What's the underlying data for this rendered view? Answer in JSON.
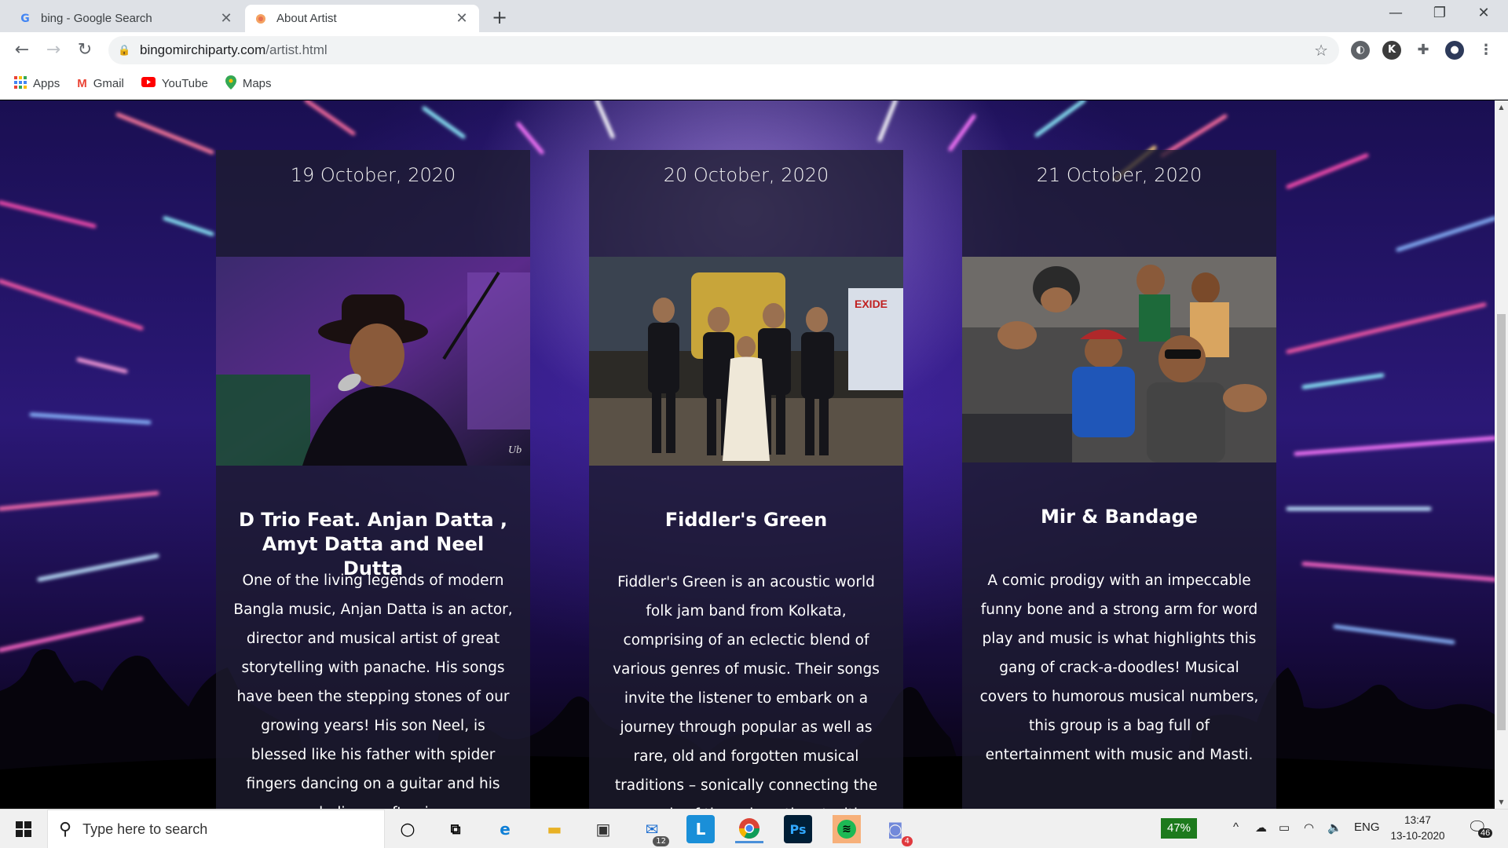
{
  "browser": {
    "tabs": [
      {
        "title": "bing - Google Search",
        "favicon": "google-icon"
      },
      {
        "title": "About Artist",
        "favicon": "site-icon"
      }
    ],
    "url_host": "bingomirchiparty.com",
    "url_path": "/artist.html",
    "bookmarks": [
      {
        "label": "Apps",
        "icon": "apps-grid-icon"
      },
      {
        "label": "Gmail",
        "icon": "gmail-icon"
      },
      {
        "label": "YouTube",
        "icon": "youtube-icon"
      },
      {
        "label": "Maps",
        "icon": "maps-icon"
      }
    ],
    "profile_initial": "K"
  },
  "artists": [
    {
      "date": "19 October, 2020",
      "name": "D Trio Feat. Anjan Datta , Amyt Datta and Neel Dutta",
      "description": "One of the living legends of modern Bangla music, Anjan Datta is an actor, director and musical artist of great storytelling with panache. His songs have been the stepping stones of our growing years! His son Neel, is blessed like his father with spider fingers dancing on a guitar and his melodious soft voice."
    },
    {
      "date": "20 October, 2020",
      "name": "Fiddler's Green",
      "description": "Fiddler's Green is an acoustic world folk jam band from Kolkata, comprising of an eclectic blend of various genres of music. Their songs invite the listener to embark on a journey through popular as well as rare, old and forgotten musical traditions – sonically connecting the sounds of the subcontinent with folklore stories from around the world."
    },
    {
      "date": "21 October, 2020",
      "name": "Mir & Bandage",
      "description": "A comic prodigy with an impeccable funny bone and a strong arm for word play and music is what highlights this gang of crack-a-doodles! Musical covers to humorous musical numbers, this group is a bag full of entertainment with music and Masti."
    }
  ],
  "taskbar": {
    "search_placeholder": "Type here to search",
    "battery": "47%",
    "language": "ENG",
    "time": "13:47",
    "date": "13-10-2020",
    "mail_badge": "12",
    "discord_badge": "4",
    "notifications_badge": "46",
    "photo_sign": "Ub",
    "banner_text": "EXIDE"
  }
}
